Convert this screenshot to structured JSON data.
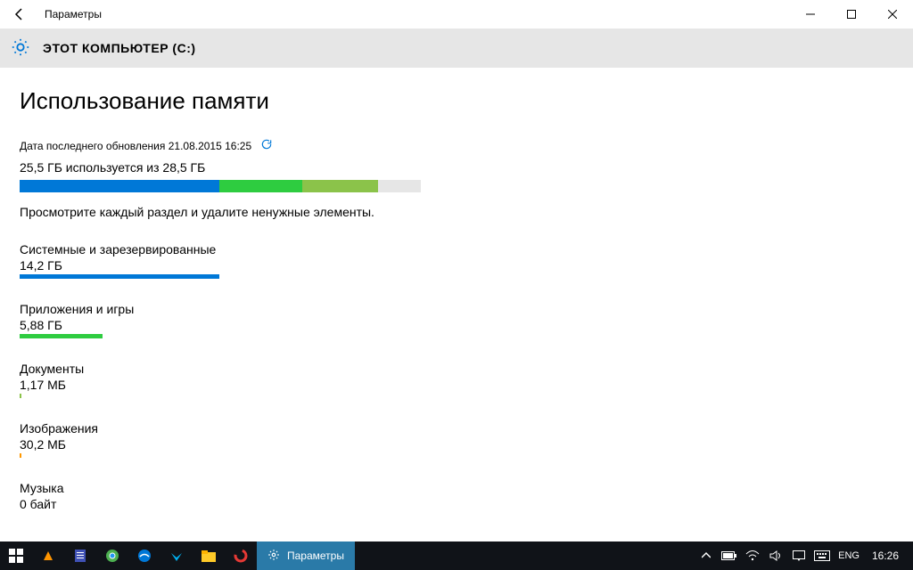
{
  "window": {
    "title": "Параметры",
    "drive_label": "ЭТОТ КОМПЬЮТЕР (C:)"
  },
  "page": {
    "heading": "Использование памяти",
    "last_updated_prefix": "Дата последнего обновления",
    "last_updated_value": "21.08.2015 16:25",
    "usage_text": "25,5 ГБ используется из 28,5 ГБ",
    "total_gb": 28.5,
    "main_segments": [
      {
        "color": "#0078d7",
        "gb": 14.2
      },
      {
        "color": "#2ecc40",
        "gb": 5.88
      },
      {
        "color": "#8bc34a",
        "gb": 5.4
      }
    ],
    "hint": "Просмотрите каждый раздел и удалите ненужные элементы.",
    "categories": [
      {
        "name": "Системные и зарезервированные",
        "value": "14,2 ГБ",
        "gb": 14.2,
        "color": "#0078d7"
      },
      {
        "name": "Приложения и игры",
        "value": "5,88 ГБ",
        "gb": 5.88,
        "color": "#2ecc40"
      },
      {
        "name": "Документы",
        "value": "1,17 МБ",
        "gb": 0.00117,
        "color": "#8bc34a"
      },
      {
        "name": "Изображения",
        "value": "30,2 МБ",
        "gb": 0.0302,
        "color": "#ff9800"
      },
      {
        "name": "Музыка",
        "value": "0 байт",
        "gb": 0,
        "color": "#9e9e9e"
      }
    ]
  },
  "taskbar": {
    "active_app_label": "Параметры",
    "lang": "ENG",
    "clock": "16:26"
  }
}
